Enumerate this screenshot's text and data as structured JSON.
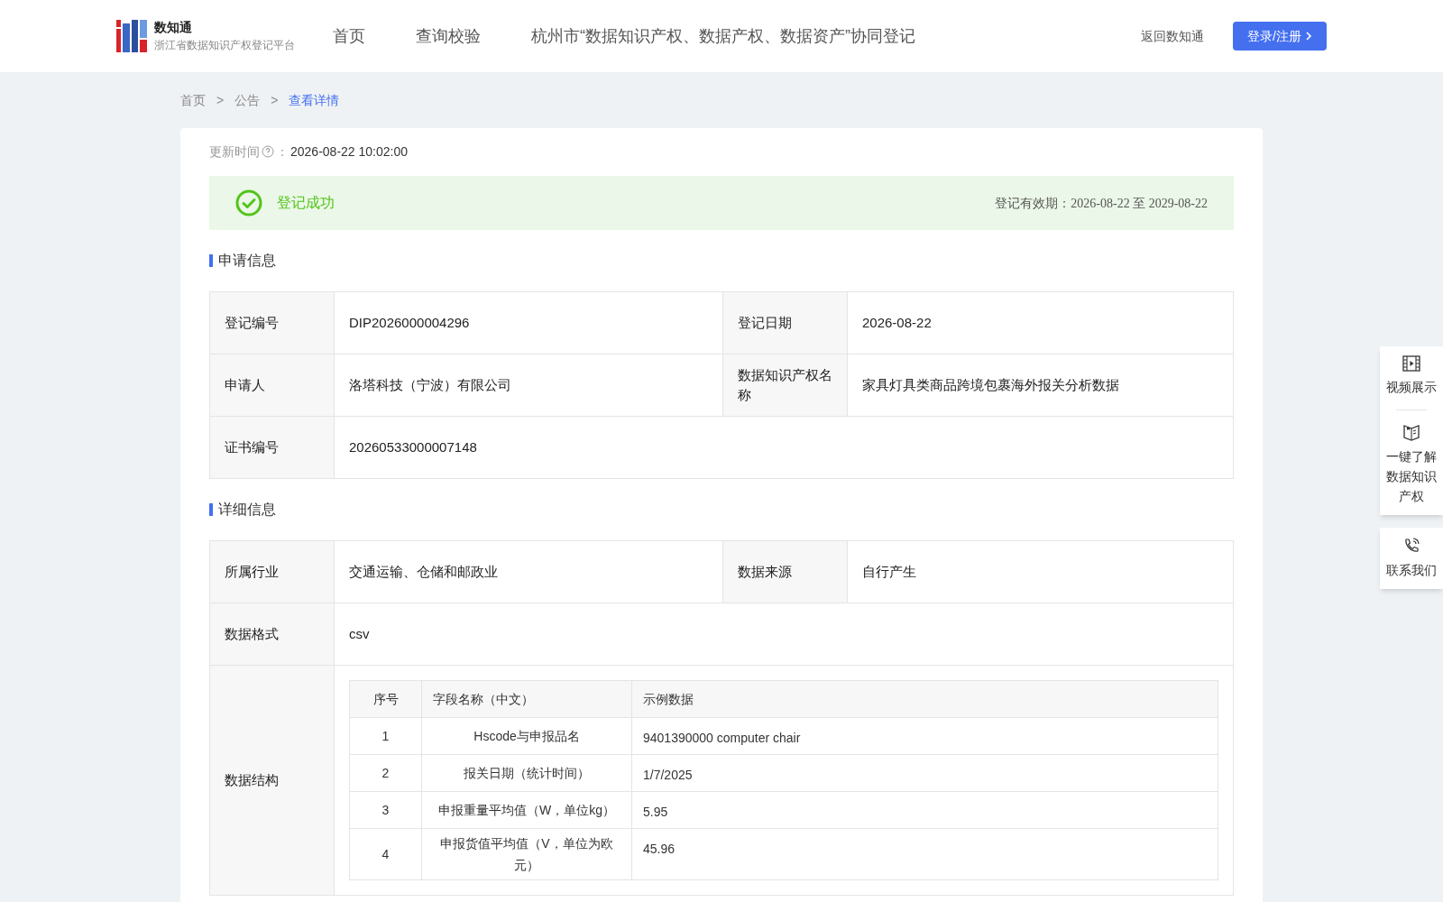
{
  "header": {
    "logo": {
      "title": "数知通",
      "subtitle": "浙江省数据知识产权登记平台"
    },
    "nav": [
      "首页",
      "查询校验",
      "杭州市“数据知识产权、数据产权、数据资产”协同登记"
    ],
    "back_link": "返回数知通",
    "login_button": "登录/注册"
  },
  "breadcrumb": [
    {
      "kind": "link",
      "label": "首页"
    },
    {
      "kind": "separator",
      "label": ">"
    },
    {
      "kind": "link",
      "label": "公告"
    },
    {
      "kind": "separator",
      "label": ">"
    },
    {
      "kind": "current",
      "label": "查看详情"
    }
  ],
  "updated": {
    "label": "更新时间",
    "colon": "：",
    "value": "2026-08-22 10:02:00"
  },
  "status": {
    "label": "登记成功",
    "validity": "登记有效期：2026-08-22 至 2029-08-22"
  },
  "sections": [
    {
      "title": "申请信息",
      "rows": [
        [
          {
            "label": "登记编号",
            "value": "DIP2026000004296"
          },
          {
            "label": "登记日期",
            "value": "2026-08-22"
          }
        ],
        [
          {
            "label": "申请人",
            "value": "洛塔科技（宁波）有限公司"
          },
          {
            "label": "数据知识产权名称",
            "value": "家具灯具类商品跨境包裹海外报关分析数据"
          }
        ],
        [
          {
            "label": "证书编号",
            "value": "20260533000007148"
          }
        ]
      ]
    },
    {
      "title": "详细信息",
      "rows": [
        [
          {
            "label": "所属行业",
            "value": "交通运输、仓储和邮政业"
          },
          {
            "label": "数据来源",
            "value": "自行产生"
          }
        ],
        [
          {
            "label": "数据格式",
            "value": "csv"
          }
        ]
      ],
      "structure": {
        "label": "数据结构",
        "columns": [
          "序号",
          "字段名称（中文）",
          "示例数据"
        ],
        "rows": [
          [
            "1",
            "Hscode与申报品名",
            "9401390000 computer chair"
          ],
          [
            "2",
            "报关日期（统计时间）",
            "1/7/2025"
          ],
          [
            "3",
            "申报重量平均值（W，单位kg）",
            "5.95"
          ],
          [
            "4",
            "申报货值平均值（V，单位为欧元）",
            "45.96"
          ]
        ]
      }
    }
  ],
  "side_panel": [
    [
      {
        "kind": "video",
        "label": "视频展示"
      },
      {
        "kind": "book",
        "label": "一键了解数据知识产权"
      }
    ],
    [
      {
        "kind": "phone",
        "label": "联系我们"
      }
    ]
  ]
}
